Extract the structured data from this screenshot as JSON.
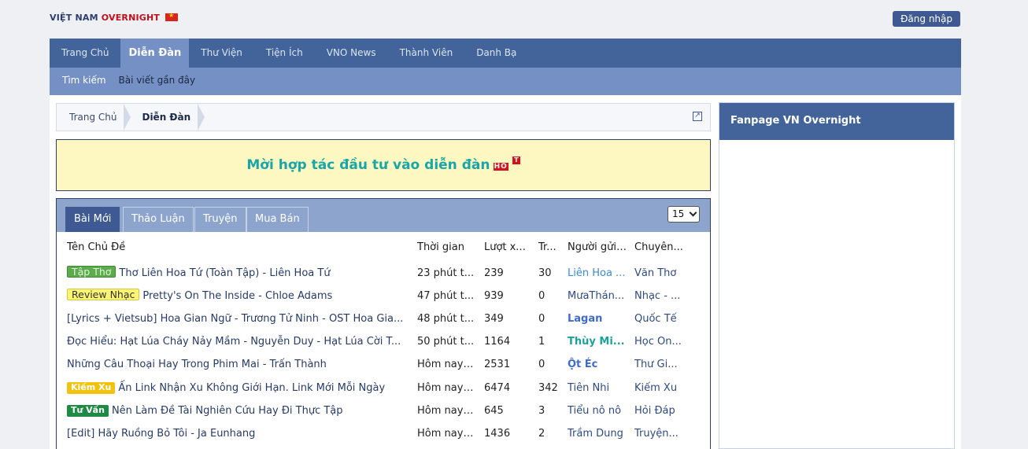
{
  "header": {
    "logo_part1": "VIỆT NAM",
    "logo_part2": "OVERNIGHT",
    "login_label": "Đăng nhập"
  },
  "nav": {
    "items": [
      "Trang Chủ",
      "Diễn Đàn",
      "Thư Viện",
      "Tiện Ích",
      "VNO News",
      "Thành Viên",
      "Danh Bạ"
    ],
    "active": "Diễn Đàn",
    "sub_items": [
      "Tìm kiếm",
      "Bài viết gần đây"
    ]
  },
  "breadcrumb": [
    "Trang Chủ",
    "Diễn Đàn"
  ],
  "banner": {
    "text": "Mời hợp tác đầu tư vào diễn đàn",
    "badge_h": "HO",
    "badge_t": "T"
  },
  "panel": {
    "tabs": [
      "Bài Mới",
      "Thảo Luận",
      "Truyện",
      "Mua Bán"
    ],
    "active_tab": "Bài Mới",
    "per_page": "15",
    "columns": [
      "Tên Chủ Đề",
      "Thời gian",
      "Lượt xem",
      "Tr...",
      "Người gửi ...",
      "Chuyên..."
    ],
    "rows": [
      {
        "prefix": "Tập Thơ",
        "title": "Thơ Liên Hoa Tứ (Toàn Tập) - Liên Hoa Tứ",
        "time": "23 phút t...",
        "views": "239",
        "replies": "30",
        "user": "Liên Hoa ...",
        "forum": "Văn Thơ"
      },
      {
        "prefix": "Review Nhạc",
        "title": "Pretty's On The Inside - Chloe Adams",
        "time": "47 phút t...",
        "views": "939",
        "replies": "0",
        "user": "MưaThán...",
        "forum": "Nhạc - ..."
      },
      {
        "prefix": "[Lyrics + Vietsub]",
        "title": "Hoa Gian Ngữ - Trương Tử Ninh - OST Hoa Gia...",
        "time": "48 phút t...",
        "views": "349",
        "replies": "0",
        "user": "Lagan",
        "forum": "Quốc Tế"
      },
      {
        "prefix": "",
        "title": "Đọc Hiểu: Hạt Lúa Cháy Nảy Mầm - Nguyễn Duy - Hạt Lúa Cời T...",
        "time": "50 phút t...",
        "views": "1164",
        "replies": "1",
        "user": "Thùy Mi...",
        "forum": "Học On..."
      },
      {
        "prefix": "",
        "title": "Những Câu Thoại Hay Trong Phim Mai - Trấn Thành",
        "time": "Hôm nay ...",
        "views": "2531",
        "replies": "0",
        "user": "Ột Éc",
        "forum": "Thư Gi..."
      },
      {
        "prefix": "Kiếm Xu",
        "title": "Ấn Link Nhận Xu Không Giới Hạn. Link Mới Mỗi Ngày",
        "time": "Hôm nay ...",
        "views": "6474",
        "replies": "342",
        "user": "Tiên Nhi",
        "forum": "Kiếm Xu"
      },
      {
        "prefix": "Tư Vấn",
        "title": "Nên Làm Đề Tài Nghiên Cứu Hay Đi Thực Tập",
        "time": "Hôm nay ...",
        "views": "645",
        "replies": "3",
        "user": "Tiểu nô nô",
        "forum": "Hỏi Đáp"
      },
      {
        "prefix": "",
        "title": "[Edit] Hãy Ruồng Bỏ Tôi - Ja Eunhang",
        "time": "Hôm nay ...",
        "views": "1436",
        "replies": "2",
        "user": "Trầm Dung",
        "forum": "Truyện..."
      }
    ]
  },
  "sidebar": {
    "title": "Fanpage VN Overnight"
  },
  "colors": {
    "nav_bg": "#42649a",
    "subnav_bg": "#7490c4",
    "banner_bg": "#fdf7c2",
    "banner_text": "#18a6a8"
  }
}
